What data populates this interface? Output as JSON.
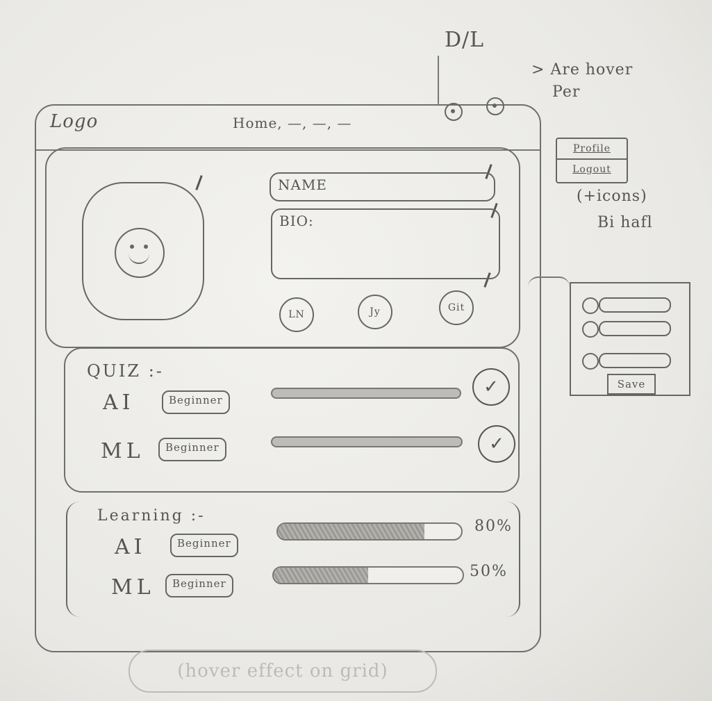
{
  "navbar": {
    "logo": "Logo",
    "links": "Home, —, —, —",
    "dark_light_label": "D/L"
  },
  "annotations": {
    "hover_note_line1": "> Are hover",
    "hover_note_line2": "Per",
    "icons_note_line1": "(+icons)",
    "icons_note_line2": "Bi hafl",
    "bottom_note": "(hover effect on grid)"
  },
  "profile_dropdown": {
    "items": [
      "Profile",
      "Logout"
    ]
  },
  "profile": {
    "name_placeholder": "NAME",
    "bio_placeholder": "BIO:",
    "social_links": [
      "LN",
      "Jy",
      "Git"
    ]
  },
  "quiz": {
    "title": "QUIZ :-",
    "rows": [
      {
        "label": "AI",
        "level": "Beginner"
      },
      {
        "label": "ML",
        "level": "Beginner"
      }
    ]
  },
  "learning": {
    "title": "Learning :-",
    "rows": [
      {
        "label": "AI",
        "level": "Beginner",
        "progress_percent": 80,
        "progress_text": "80%"
      },
      {
        "label": "ML",
        "level": "Beginner",
        "progress_percent": 50,
        "progress_text": "50%"
      }
    ]
  },
  "edit_panel": {
    "save_label": "Save"
  }
}
